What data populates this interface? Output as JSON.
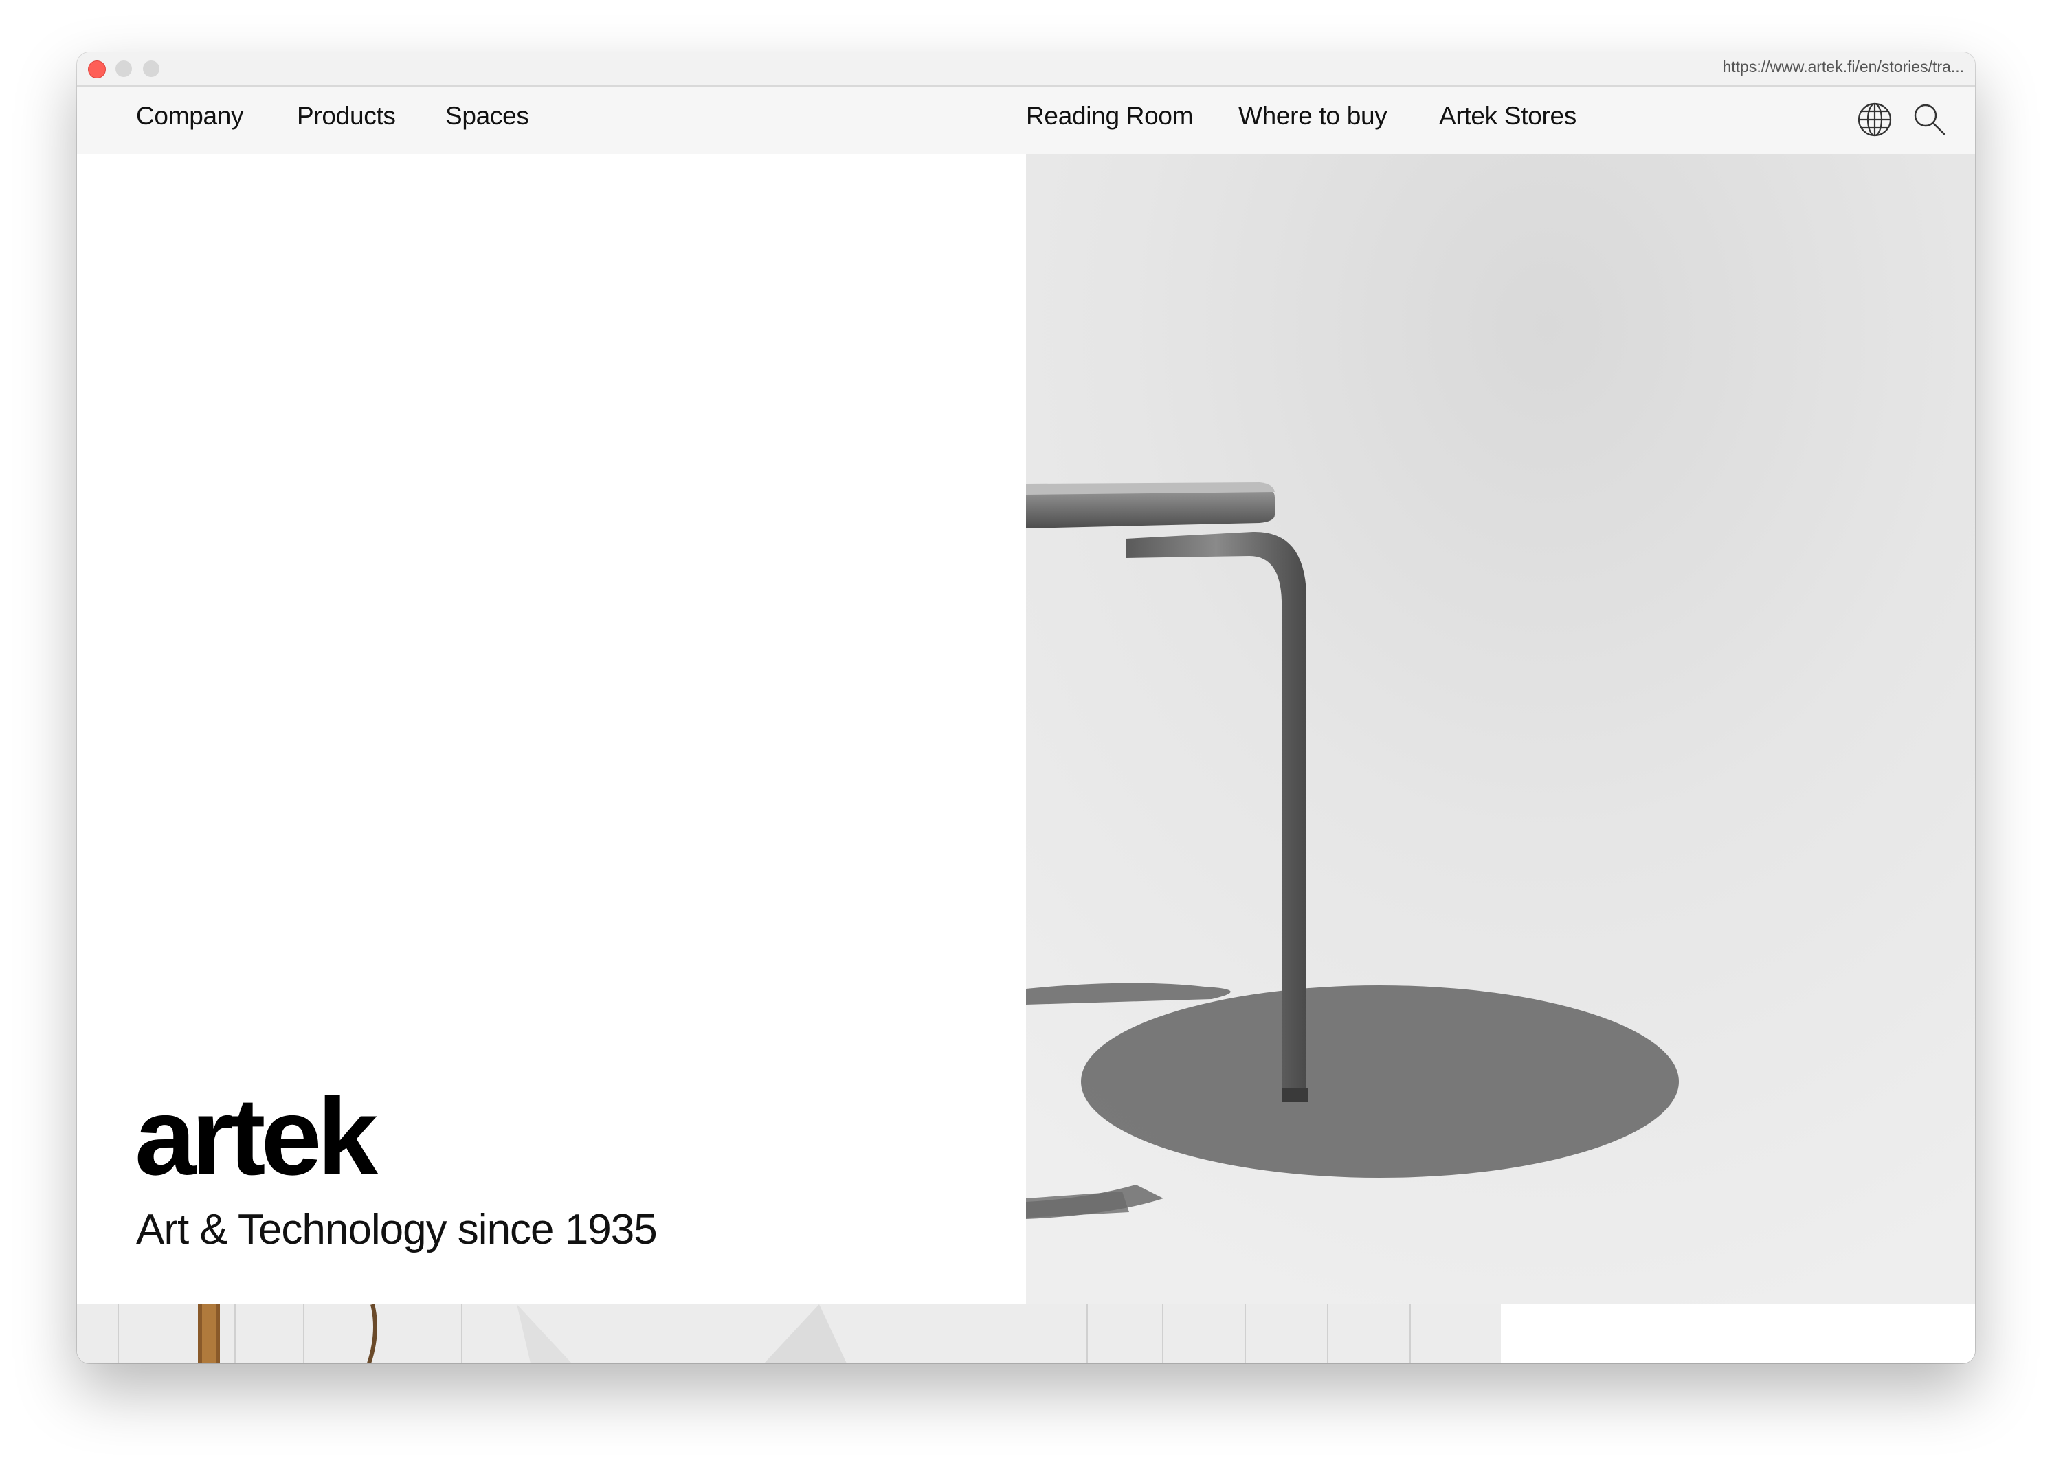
{
  "browser": {
    "url": "https://www.artek.fi/en/stories/tra..."
  },
  "nav": {
    "left": [
      "Company",
      "Products",
      "Spaces"
    ],
    "right": [
      "Reading Room",
      "Where to buy",
      "Artek Stores"
    ],
    "icons": [
      "globe-icon",
      "search-icon"
    ]
  },
  "hero": {
    "logo": "artek",
    "tagline": "Art & Technology since 1935",
    "image": "black-and-white photo of a bent-wood stool leg casting a round shadow"
  },
  "colors": {
    "nav_bg": "#f6f6f6",
    "text": "#111111",
    "photo_bg": "#e7e7e7"
  }
}
